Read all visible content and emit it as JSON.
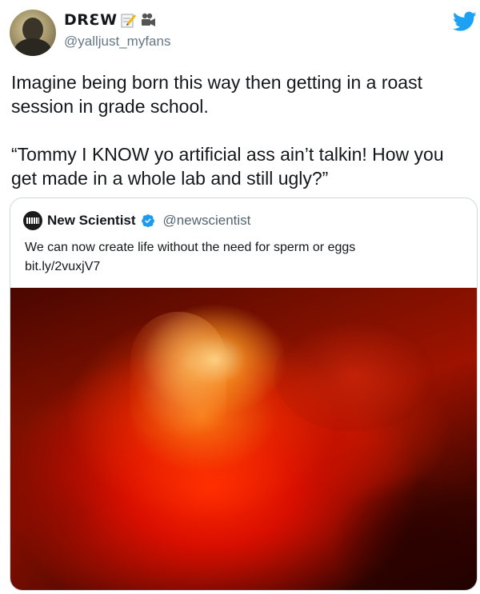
{
  "author": {
    "display_name": "DRƐW",
    "handle": "@yalljust_myfans",
    "name_emojis": [
      "pencil-icon",
      "movie-camera-icon"
    ]
  },
  "tweet": {
    "paragraphs": [
      "Imagine being born this way then getting in a roast session in grade school.",
      "“Tommy I KNOW yo artificial ass ain’t talkin! How you get made in a whole lab and still ugly?”"
    ]
  },
  "quoted_tweet": {
    "name": "New Scientist",
    "handle": "@newscientist",
    "verified": true,
    "text_line1": "We can now create life without the need for sperm or eggs",
    "text_line2": "bit.ly/2vuxjV7"
  },
  "colors": {
    "twitter_blue": "#1da1f2",
    "handle_gray": "#657786",
    "verified_blue": "#1d9bf0"
  }
}
